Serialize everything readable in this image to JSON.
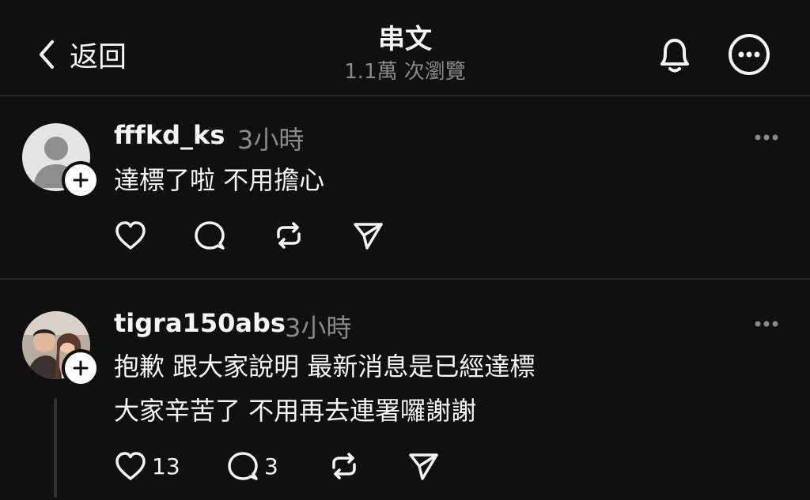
{
  "header": {
    "back_label": "返回",
    "title": "串文",
    "views": "1.1萬 次瀏覽",
    "icons": [
      "chevron-left-icon",
      "bell-icon",
      "more-horizontal-circle-icon"
    ]
  },
  "posts": [
    {
      "username": "fffkd_ks",
      "time": "3小時",
      "lines": [
        "達標了啦 不用擔心"
      ],
      "likes": "",
      "replies": "",
      "avatar": "default-avatar"
    },
    {
      "username": "tigra150abs",
      "time": "3小時",
      "lines": [
        "抱歉 跟大家說明 最新消息是已經達標",
        "大家辛苦了 不用再去連署囉謝謝"
      ],
      "likes": "13",
      "replies": "3",
      "avatar": "photo-avatar"
    }
  ],
  "colors": {
    "background": "#101010",
    "text": "#f3f5f7",
    "secondary": "#8a8a8a",
    "divider": "#2a2a2a"
  }
}
